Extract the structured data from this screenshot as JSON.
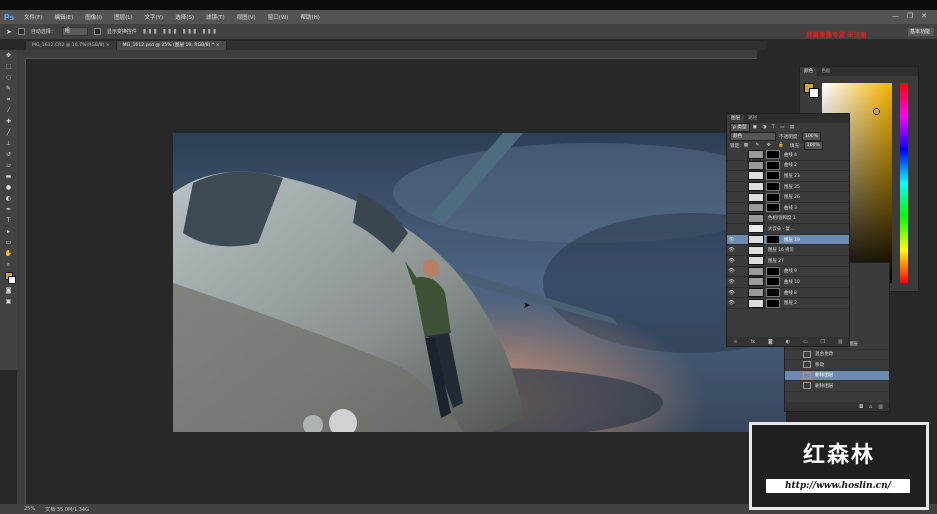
{
  "menubar": {
    "logo": "Ps",
    "items": [
      "文件(F)",
      "编辑(E)",
      "图像(I)",
      "图层(L)",
      "文字(Y)",
      "选择(S)",
      "滤镜(T)",
      "视图(V)",
      "窗口(W)",
      "帮助(H)"
    ],
    "window_controls": [
      "—",
      "❐",
      "✕"
    ]
  },
  "options": {
    "auto_select_label": "自动选择：",
    "auto_select_value": "组",
    "show_transform_label": "显示变换控件",
    "recording_text": "屏幕录像专家 未注册",
    "workspace": "基本功能"
  },
  "tabs": [
    {
      "label": "MG_1612.CR2 @ 16.7%(RGB/8) ×",
      "active": false
    },
    {
      "label": "MG_1612.psd @ 25% (图层 19, RGB/8) * ×",
      "active": true
    }
  ],
  "status": {
    "zoom": "25%",
    "doc": "文档:35.0M/1.34G"
  },
  "color_panel": {
    "tabs": [
      "颜色",
      "色板"
    ],
    "foreground_color": "#d6a531",
    "background_color": "#ffffff"
  },
  "history": {
    "items": [
      {
        "label": "修改色相/饱和度图层",
        "selected": false
      },
      {
        "label": "混合更改",
        "selected": false
      },
      {
        "label": "移动",
        "selected": false
      },
      {
        "label": "删除图层",
        "selected": true
      },
      {
        "label": "删除图层",
        "selected": false
      }
    ]
  },
  "layers": {
    "tabs": [
      "图层",
      "路径"
    ],
    "filter": "ρ 类型",
    "blend_mode": "颜色",
    "opacity_label": "不透明度:",
    "opacity": "100%",
    "lock_label": "锁定:",
    "fill_label": "填充:",
    "fill": "100%",
    "rows": [
      {
        "name": "曲线 4",
        "selected": false,
        "eye": "",
        "thumb": "#9a9a9a",
        "mask": true
      },
      {
        "name": "曲线 2",
        "selected": false,
        "eye": "",
        "thumb": "#9a9a9a",
        "mask": true
      },
      {
        "name": "图层 23",
        "selected": false,
        "eye": "",
        "thumb": "#dddddd",
        "mask": true
      },
      {
        "name": "图层 25",
        "selected": false,
        "eye": "",
        "thumb": "#dddddd",
        "mask": true
      },
      {
        "name": "图层 26",
        "selected": false,
        "eye": "",
        "thumb": "#dddddd",
        "mask": true
      },
      {
        "name": "曲线 3",
        "selected": false,
        "eye": "",
        "thumb": "#9a9a9a",
        "mask": true
      },
      {
        "name": "色相/饱和度 1",
        "selected": false,
        "eye": "",
        "thumb": "#9a9a9a",
        "mask": false
      },
      {
        "name": "大云朵 - 复...",
        "selected": false,
        "eye": "",
        "thumb": "#eeeeee",
        "mask": false
      },
      {
        "name": "图层 19",
        "selected": true,
        "eye": "👁",
        "thumb": "#dddddd",
        "mask": true
      },
      {
        "name": "图层 16 拷贝",
        "selected": false,
        "eye": "👁",
        "thumb": "#dddddd",
        "mask": false
      },
      {
        "name": "图层 27",
        "selected": false,
        "eye": "👁",
        "thumb": "#dddddd",
        "mask": false
      },
      {
        "name": "曲线 9",
        "selected": false,
        "eye": "👁",
        "thumb": "#9a9a9a",
        "mask": true
      },
      {
        "name": "曲线 10",
        "selected": false,
        "eye": "👁",
        "thumb": "#9a9a9a",
        "mask": true
      },
      {
        "name": "曲线 8",
        "selected": false,
        "eye": "👁",
        "thumb": "#9a9a9a",
        "mask": true
      },
      {
        "name": "图层 2",
        "selected": false,
        "eye": "👁",
        "thumb": "#dddddd",
        "mask": true
      }
    ]
  },
  "watermark": {
    "title": "红森林",
    "url": "http://www.hoslin.cn/"
  }
}
